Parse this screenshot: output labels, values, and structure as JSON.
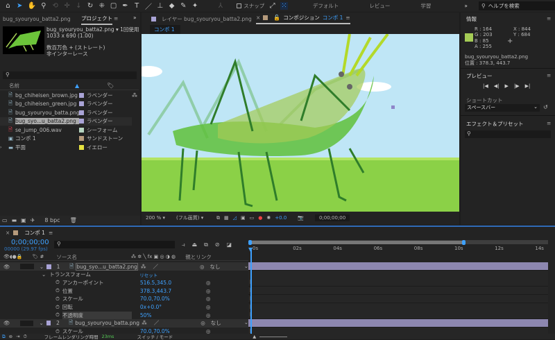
{
  "toolbar": {
    "tools": [
      "home-icon",
      "selection-icon",
      "hand-icon",
      "zoom-icon",
      "orbit-icon",
      "pan-icon",
      "dolly-icon",
      "rotate-icon",
      "anchor-icon",
      "rectangle-icon",
      "pen-icon",
      "text-icon",
      "brush-icon",
      "clone-stamp-icon",
      "eraser-icon",
      "roto-brush-icon",
      "puppet-pin-icon"
    ],
    "snap_label": "スナップ",
    "workspaces": [
      "デフォルト",
      "レビュー",
      "学習"
    ],
    "help_placeholder": "ヘルプを検索"
  },
  "project": {
    "prev_tab": "bug_syouryou_batta2.png",
    "tab": "プロジェクト",
    "thumb_name": "bug_syouryou_batta2.png ▾",
    "usage": "1回使用",
    "dims": "1033 x 690 (1.00)",
    "color": "数百万色 + (ストレート)",
    "interlace": "非インターレース",
    "col_name": "名前",
    "items": [
      {
        "name": "bg_chiheisen_brown.jpg",
        "label": "ラベンダー",
        "color": "#a9a3d6",
        "type": "file"
      },
      {
        "name": "bg_chiheisen_green.jpg",
        "label": "ラベンダー",
        "color": "#a9a3d6",
        "type": "file"
      },
      {
        "name": "bug_syouryou_batta.png",
        "label": "ラベンダー",
        "color": "#a9a3d6",
        "type": "file"
      },
      {
        "name": "bug_syo...u_batta2.png",
        "label": "ラベンダー",
        "color": "#a9a3d6",
        "type": "file",
        "selected": true
      },
      {
        "name": "se_jump_006.wav",
        "label": "シーフォーム",
        "color": "#b6d4c0",
        "type": "audio"
      },
      {
        "name": "コンポ 1",
        "label": "サンドストーン",
        "color": "#b59a7c",
        "type": "comp"
      },
      {
        "name": "平面",
        "label": "イエロー",
        "color": "#e6e340",
        "type": "folder"
      }
    ],
    "bpc": "8 bpc"
  },
  "comp": {
    "layer_tab": "レイヤー bug_syouryou_batta2.png",
    "comp_tab_prefix": "コンポジション",
    "comp_tab_name": "コンポ 1",
    "breadcrumb": "コンポ 1",
    "zoom": "200 %",
    "quality": "(フル画質)",
    "exposure": "+0.0",
    "timecode": "0;00;00;00"
  },
  "info": {
    "title": "情報",
    "swatch": "#a4cb55",
    "r": "R :  164",
    "g": "G :  203",
    "b": "B :  85",
    "a": "A :  255",
    "x": "X :  844",
    "y": "Y :  684",
    "layer": "bug_syouryou_batta2.png",
    "position": "位置 : 378.3, 443.7"
  },
  "preview": {
    "title": "プレビュー",
    "shortcut_label": "ショートカット",
    "shortcut_value": "スペースバー"
  },
  "effects": {
    "title": "エフェクト＆プリセット"
  },
  "timeline": {
    "tab": "コンポ 1",
    "time": "0;00;00;00",
    "fps": "00000 (29.97 fps)",
    "col_source": "ソース名",
    "col_parent": "親とリンク",
    "switch_icons": "⁂ ✲ ╲ fx ▣ ◎ ◑ ◍",
    "ruler": [
      "0s",
      "02s",
      "04s",
      "06s",
      "08s",
      "10s",
      "12s",
      "14s"
    ],
    "layer1": {
      "num": "1",
      "name": "bug_syo...u_batta2.png",
      "parent": "なし"
    },
    "transform": "トランスフォーム",
    "reset": "リセット",
    "props": [
      {
        "name": "アンカーポイント",
        "value": "516.5,345.0"
      },
      {
        "name": "位置",
        "value": "378.3,443.7"
      },
      {
        "name": "スケール",
        "value": "70.0,70.0%"
      },
      {
        "name": "回転",
        "value": "0x+0.0°"
      },
      {
        "name": "不透明度",
        "value": "50%"
      }
    ],
    "layer2": {
      "num": "2",
      "name": "bug_syouryou_batta.png",
      "parent": "なし"
    },
    "layer2_prop": {
      "name": "スケール",
      "value": "70.0,70.0%"
    },
    "render_label": "フレームレンダリング時間",
    "render_time": "23ms",
    "switch_mode": "スイッチ / モード"
  }
}
